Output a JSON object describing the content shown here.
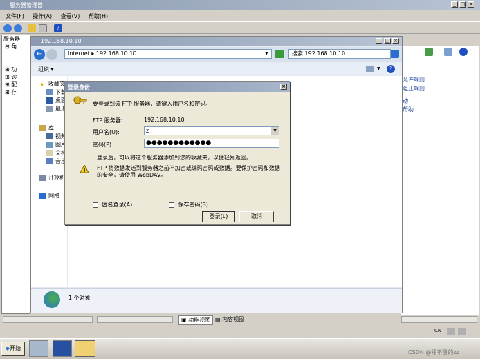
{
  "main_window": {
    "title": "服务器管理器",
    "menu": [
      "文件(F)",
      "操作(A)",
      "查看(V)",
      "帮助(H)"
    ],
    "left_tree": [
      "服务器",
      "角",
      "功",
      "诊",
      "配",
      "存"
    ]
  },
  "right_pane": {
    "actions": [
      "允许规则...",
      "阻止规则...",
      "动",
      "帮助"
    ]
  },
  "explorer": {
    "title": "192.168.10.10",
    "address": "Internet ▸ 192.168.10.10",
    "search_placeholder": "搜索 192.168.10.10",
    "organize": "组织",
    "favorites_header": "收藏夹",
    "favorites": [
      "下载",
      "桌面",
      "最近"
    ],
    "libraries_header": "库",
    "libraries": [
      "视频",
      "图片",
      "文档",
      "音乐"
    ],
    "computer": "计算机",
    "network": "网络",
    "status_text": "1 个对象"
  },
  "dialog": {
    "title": "登录身份",
    "prompt": "要登录到该 FTP 服务器，请键入用户名和密码。",
    "server_label": "FTP 服务器:",
    "server_value": "192.168.10.10",
    "username_label": "用户名(U):",
    "username_value": "z",
    "password_label": "密码(P):",
    "password_value": "●●●●●●●●●●●●",
    "note": "登录后，可以将这个服务器添加到您的收藏夹，以便轻易返回。",
    "warning": "FTP 将数据发送到服务器之前不加密或编码密码或数据。要保护密码和数据的安全，请使用 WebDAV。",
    "anonymous_label": "匿名登录(A)",
    "save_password_label": "保存密码(S)",
    "login_button": "登录(L)",
    "cancel_button": "取消"
  },
  "bottom_views": {
    "feature_view": "功能视图",
    "content_view": "内容视图"
  },
  "taskbar": {
    "start": "开始",
    "lang": "CN",
    "watermark": "CSDN @睡不醒的zz"
  }
}
